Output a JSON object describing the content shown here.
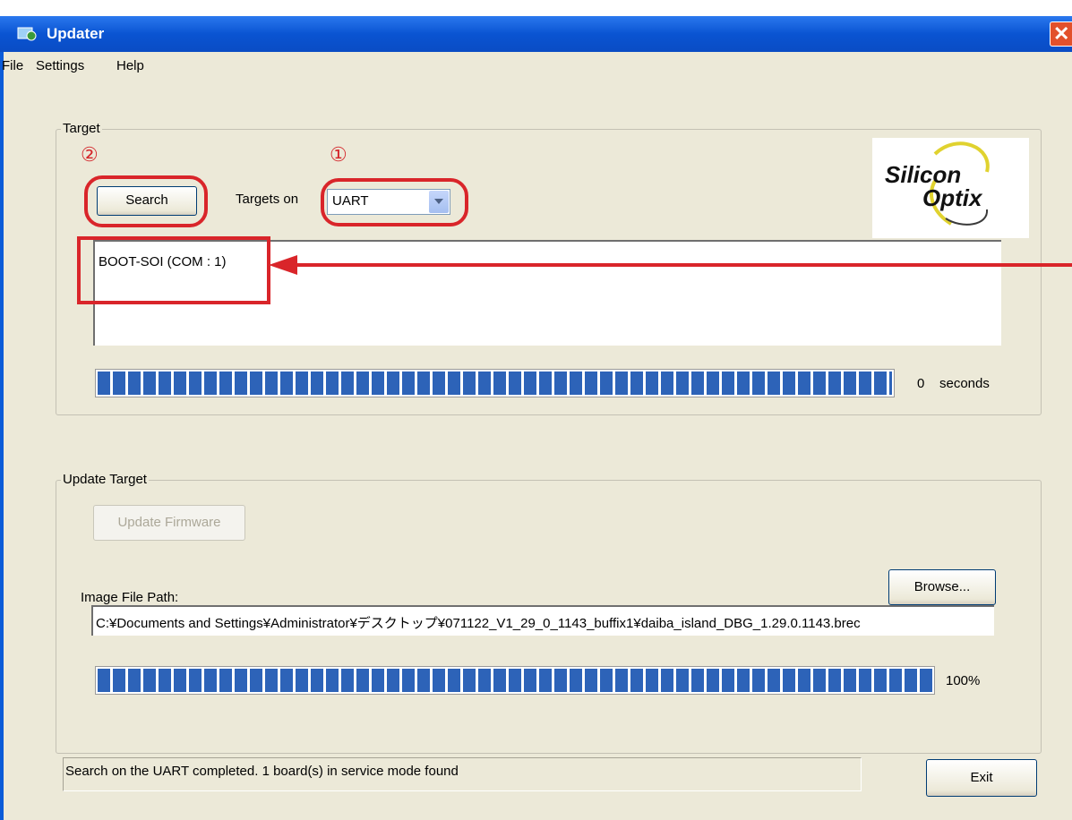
{
  "window": {
    "title": "Updater",
    "close_symbol": "✕"
  },
  "menu": [
    "File",
    "Settings",
    "Help"
  ],
  "target": {
    "group_label": "Target",
    "step_search": "②",
    "step_port": "①",
    "search_label": "Search",
    "targets_on_label": "Targets on",
    "port_selected": "UART",
    "found_target": "BOOT-SOI (COM : 1)",
    "logo_line1": "Silicon",
    "logo_line2": "Optix",
    "progress_fraction": 1.0,
    "time_value": "0",
    "time_unit": "seconds"
  },
  "update": {
    "group_label": "Update Target",
    "update_firmware_label": "Update Firmware",
    "image_path_label": "Image File Path:",
    "browse_label": "Browse...",
    "image_path_value": "C:¥Documents and Settings¥Administrator¥デスクトップ¥071122_V1_29_0_1143_buffix1¥daiba_island_DBG_1.29.0.1143.brec",
    "progress_fraction": 1.0,
    "progress_text": "100%"
  },
  "status": {
    "message": "Search on the UART completed. 1 board(s) in service mode found",
    "exit_label": "Exit"
  },
  "colors": {
    "titlebar": "#0a54d2",
    "annotation": "#d9252a",
    "progress": "#2d63b8"
  }
}
